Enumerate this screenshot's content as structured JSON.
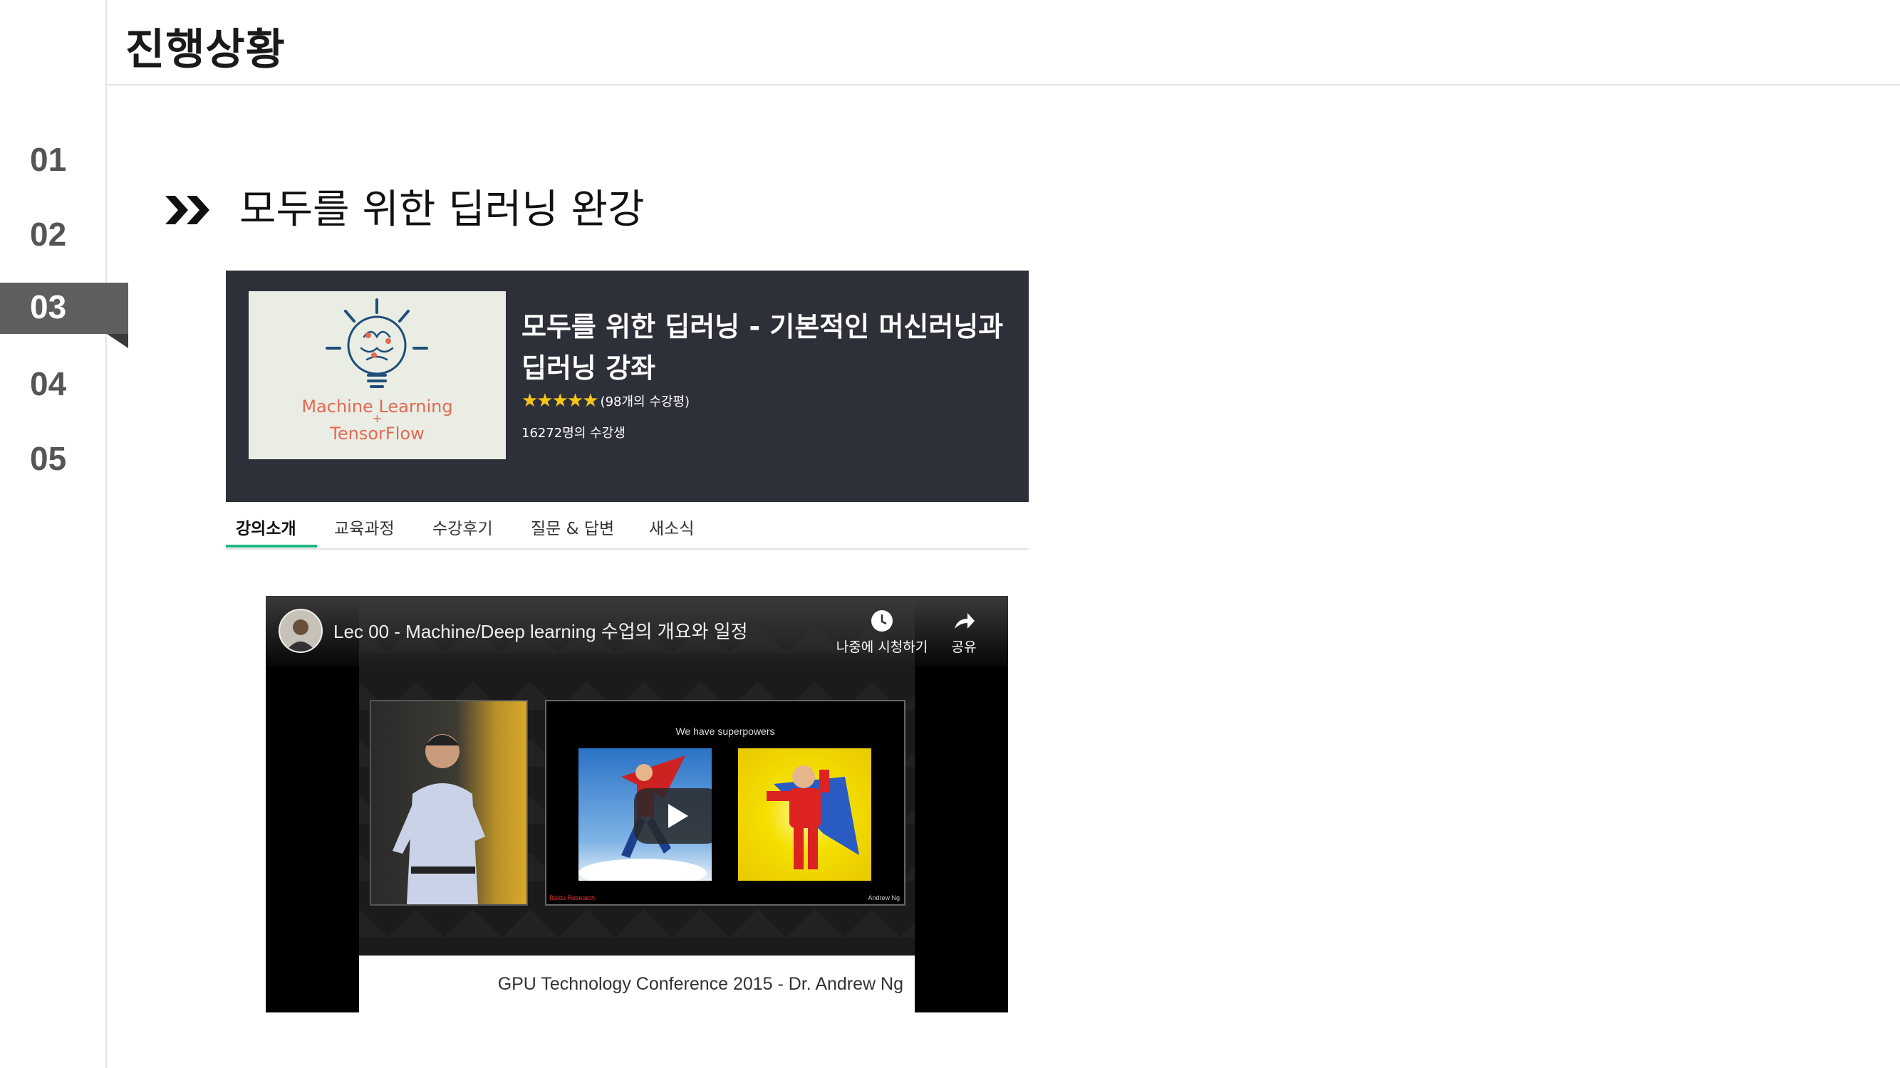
{
  "header": {
    "title": "진행상황"
  },
  "nav": {
    "items": [
      "01",
      "02",
      "03",
      "04",
      "05"
    ],
    "active_index": 2
  },
  "section": {
    "heading": "모두를 위한 딥러닝 완강"
  },
  "course": {
    "thumbnail_text_1": "Machine Learning",
    "thumbnail_plus": "+",
    "thumbnail_text_2": "TensorFlow",
    "title_line_1": "모두를 위한 딥러닝 - 기본적인 머신러닝과",
    "title_line_2": "딥러닝 강좌",
    "stars": "★★★★★",
    "rating_value": 5,
    "rating_text": "(98개의 수강평)",
    "students": "16272명의 수강생"
  },
  "tabs": [
    {
      "label": "강의소개",
      "active": true
    },
    {
      "label": "교육과정",
      "active": false
    },
    {
      "label": "수강후기",
      "active": false
    },
    {
      "label": "질문 & 답변",
      "active": false
    },
    {
      "label": "새소식",
      "active": false
    }
  ],
  "video": {
    "title": "Lec 00 - Machine/Deep learning 수업의 개요와 일정",
    "watch_later": "나중에 시청하기",
    "share": "공유",
    "slide_caption": "We have superpowers",
    "slide_footer_left": "Baidu Research",
    "slide_footer_right": "Andrew Ng",
    "caption": "GPU Technology Conference 2015 - Dr. Andrew Ng"
  },
  "colors": {
    "card_bg": "#2e3039",
    "tab_accent": "#1fb57f",
    "nav_active": "#5e5e5e",
    "stars": "#f5c518"
  }
}
